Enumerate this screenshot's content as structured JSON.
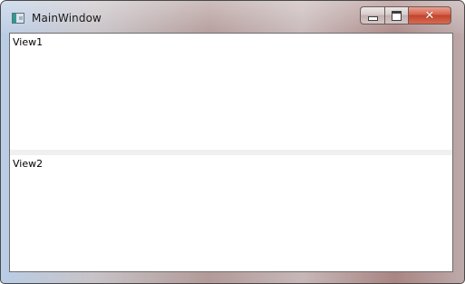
{
  "window": {
    "title": "MainWindow",
    "icon": "wpf-app-icon"
  },
  "caption_buttons": {
    "minimize_icon": "minimize-icon",
    "maximize_icon": "maximize-icon",
    "close_glyph": "✕"
  },
  "views": [
    {
      "label": "View1"
    },
    {
      "label": "View2"
    }
  ],
  "colors": {
    "close_button": "#c2432c",
    "client_background": "#ffffff",
    "splitter": "#f0f0f0"
  }
}
